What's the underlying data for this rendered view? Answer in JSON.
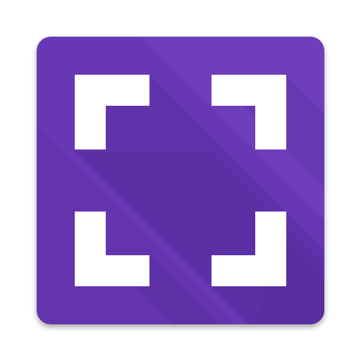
{
  "icon": {
    "name": "fullscreen-icon",
    "colors": {
      "tile": "#6838B4",
      "tile_light": "#7444C2",
      "tile_dark": "#5F31A8",
      "shadow": "#4E2790",
      "brackets": "#FFFFFF"
    }
  }
}
